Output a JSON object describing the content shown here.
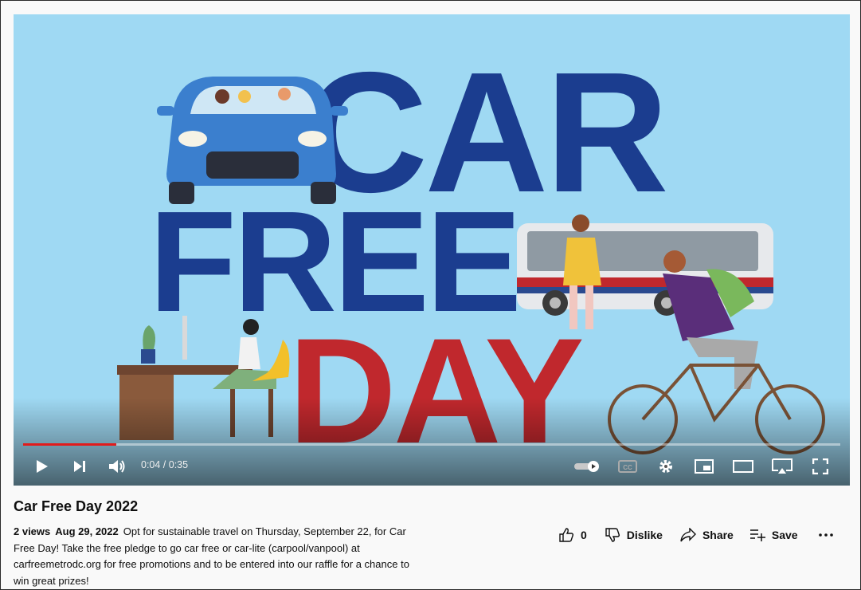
{
  "video": {
    "art_text": {
      "line1": "CAR",
      "line2": "FREE",
      "line3": "DAY"
    },
    "progress_percent": 11.4,
    "time_display": "0:04 / 0:35"
  },
  "meta": {
    "title": "Car Free Day 2022",
    "views": "2 views",
    "date": "Aug 29, 2022",
    "description": "Opt for sustainable travel on Thursday, September 22, for Car Free Day! Take the free pledge to go car free or car-lite (carpool/vanpool) at carfreemetrodc.org for free promotions and to be entered into our raffle for a chance to win great prizes!"
  },
  "actions": {
    "like_count": "0",
    "dislike_label": "Dislike",
    "share_label": "Share",
    "save_label": "Save",
    "more_icon": "more-horizontal-icon"
  },
  "colors": {
    "sky": "#9fd9f3",
    "navy_text": "#1b3d8f",
    "red_text": "#c0282d",
    "progress": "#e21b1b"
  }
}
